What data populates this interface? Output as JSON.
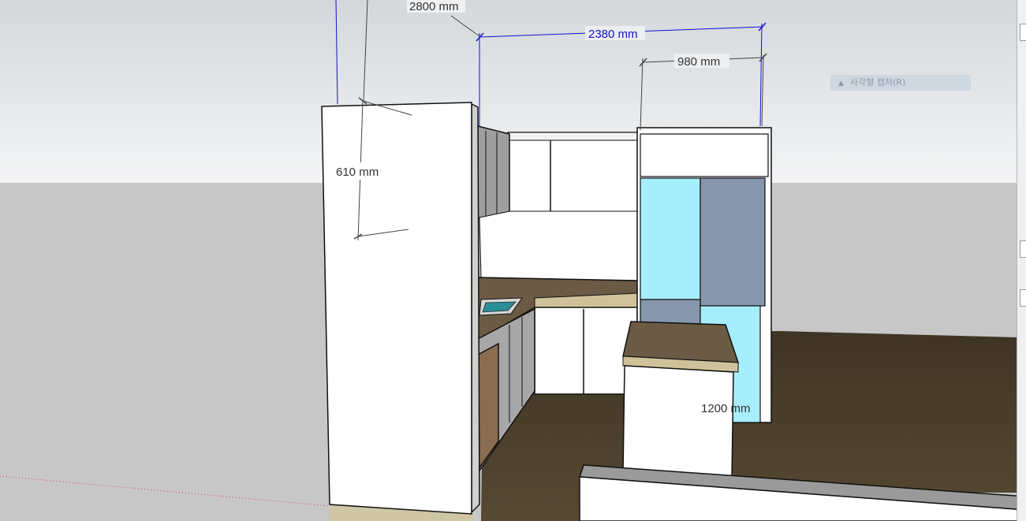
{
  "viewport": {
    "dimensions": {
      "height_upper": "2800 mm",
      "width_total": "2380 mm",
      "width_fridge": "980 mm",
      "depth_tall_unit": "610 mm",
      "island_length": "1200 mm"
    }
  },
  "tooltip": {
    "icon": "triangle-up-icon",
    "label": "사각형 캡처(R)"
  },
  "colors": {
    "sky_top": "#d4d8db",
    "sky_bottom": "#f3f4f5",
    "ground": "#c7c7c7",
    "floor": "#4a3e2b",
    "cabinet": "#ffffff",
    "countertop": "#6b5b45",
    "fridge_cyan": "#a6eefc",
    "fridge_slate": "#8596ad",
    "dimension_blue": "#1111cc"
  }
}
